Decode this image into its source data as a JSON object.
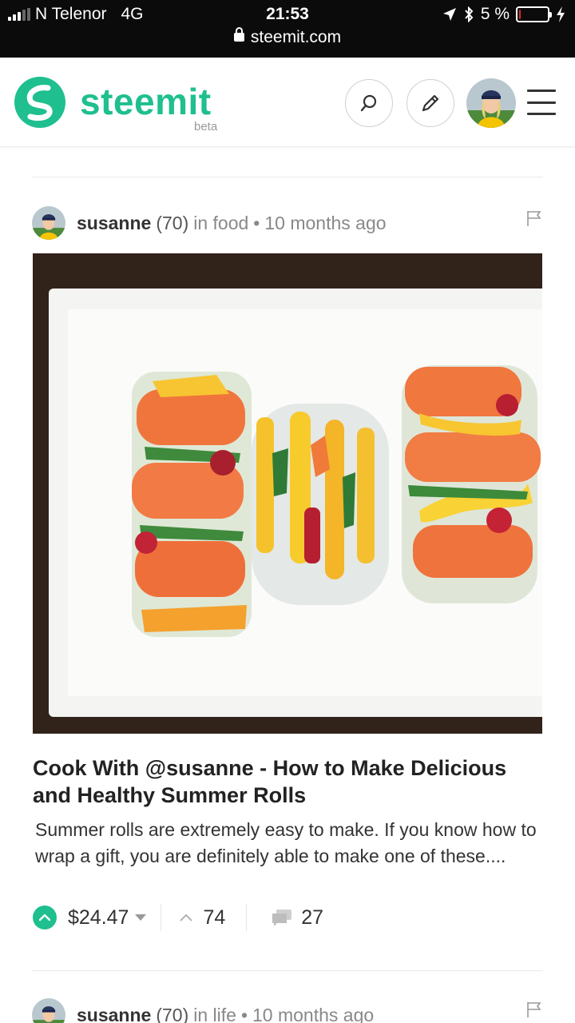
{
  "status_bar": {
    "carrier": "N Telenor",
    "network": "4G",
    "time": "21:53",
    "url": "steemit.com",
    "battery": "5 %",
    "battery_level": 0.05
  },
  "header": {
    "logo_text": "steemit",
    "logo_beta": "beta",
    "brand_color": "#1fbf8f",
    "icons": [
      "search-icon",
      "pencil-icon",
      "avatar",
      "hamburger-menu-icon"
    ]
  },
  "posts": [
    {
      "author": "susanne",
      "reputation": "(70)",
      "category": "in food",
      "separator": "•",
      "age": "10 months ago",
      "title": "Cook With @susanne - How to Make Delicious and Healthy Summer Rolls",
      "excerpt": "Summer rolls are extremely easy to make. If you know how to wrap a gift, you are definitely able to make one of these....",
      "payout": "$24.47",
      "votes": "74",
      "comments": "27"
    },
    {
      "author": "susanne",
      "reputation": "(70)",
      "category": "in life",
      "separator": "•",
      "age": "10 months ago"
    }
  ]
}
